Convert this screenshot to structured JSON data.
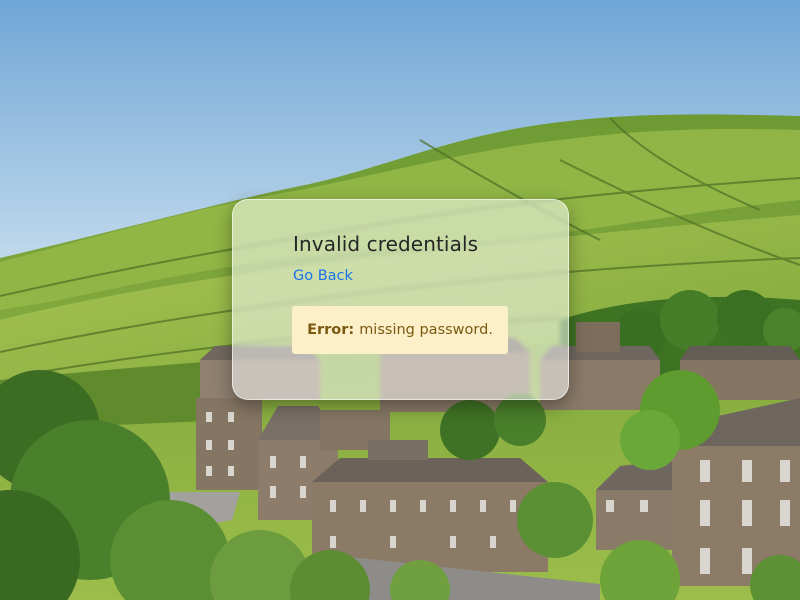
{
  "dialog": {
    "title": "Invalid credentials",
    "back_link": "Go Back",
    "error_label": "Error:",
    "error_message": "missing password."
  },
  "background": {
    "sky_top": "#6fa6d6",
    "sky_bottom": "#e9f1f6",
    "hill": "#7aa43c",
    "stone": "#8a7a66",
    "roof": "#6b625a",
    "foliage": "#4f8a2a"
  },
  "colors": {
    "link": "#1a73e8",
    "error_bg": "#fdf0c8",
    "error_text": "#7a5a12"
  }
}
